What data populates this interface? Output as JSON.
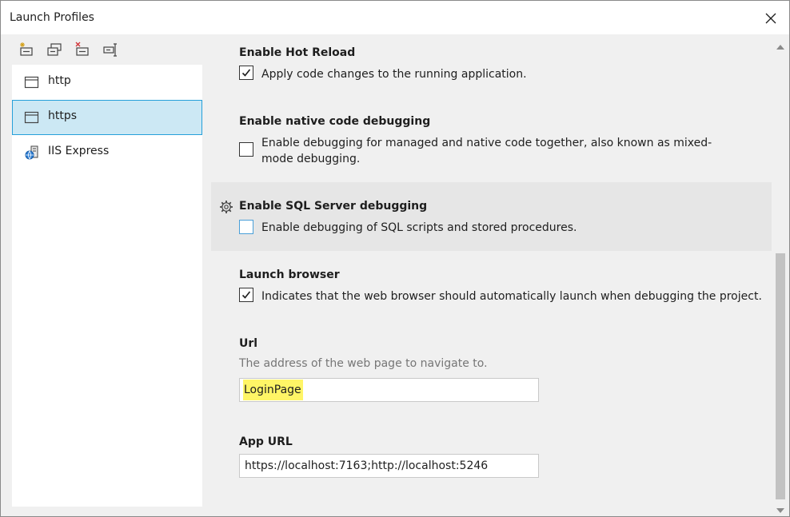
{
  "window": {
    "title": "Launch Profiles"
  },
  "toolbar": {
    "buttons": [
      {
        "icon": "new-profile-icon"
      },
      {
        "icon": "duplicate-profile-icon"
      },
      {
        "icon": "delete-profile-icon"
      },
      {
        "icon": "rename-profile-icon"
      }
    ]
  },
  "profiles": [
    {
      "label": "http",
      "icon": "window-icon",
      "selected": false
    },
    {
      "label": "https",
      "icon": "window-icon",
      "selected": true
    },
    {
      "label": "IIS Express",
      "icon": "iis-globe-icon",
      "selected": false
    }
  ],
  "settings": {
    "hot_reload": {
      "heading": "Enable Hot Reload",
      "desc": "Apply code changes to the running application.",
      "checked": true
    },
    "native_debug": {
      "heading": "Enable native code debugging",
      "desc": "Enable debugging for managed and native code together, also known as mixed-mode debugging.",
      "checked": false
    },
    "sql_debug": {
      "heading": "Enable SQL Server debugging",
      "desc": "Enable debugging of SQL scripts and stored procedures.",
      "checked": false
    },
    "launch_browser": {
      "heading": "Launch browser",
      "desc": "Indicates that the web browser should automatically launch when debugging the project.",
      "checked": true
    },
    "url": {
      "heading": "Url",
      "sub": "The address of the web page to navigate to.",
      "value": "LoginPage",
      "highlight_color": "#fff566"
    },
    "app_url": {
      "heading": "App URL",
      "value": "https://localhost:7163;http://localhost:5246"
    }
  },
  "colors": {
    "selection_bg": "#cce8f4",
    "selection_border": "#26a0da",
    "checkbox_focus": "#4a9fd8"
  }
}
